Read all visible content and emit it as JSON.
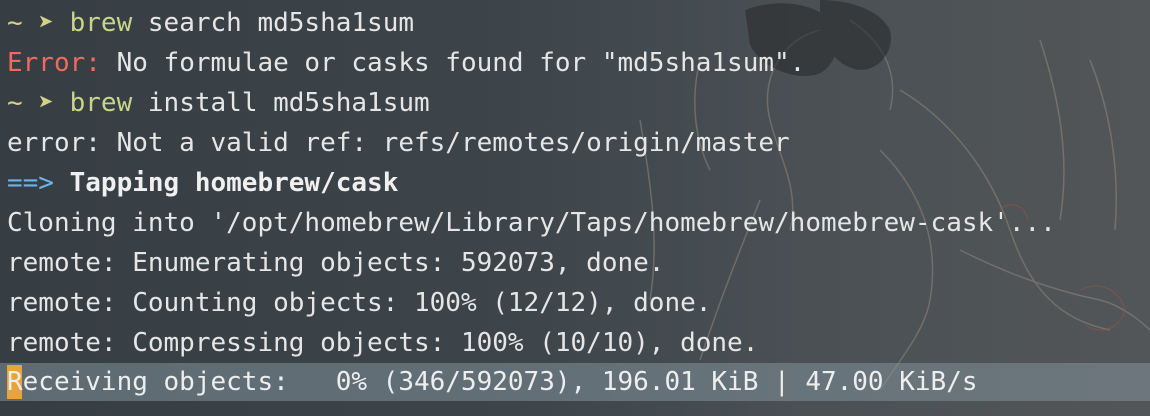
{
  "terminal": {
    "lines": [
      {
        "prompt": "~ ➤ ",
        "command": "brew",
        "args": " search md5sha1sum"
      },
      {
        "error_label": "Error:",
        "text": " No formulae or casks found for \"md5sha1sum\"."
      },
      {
        "prompt": "~ ➤ ",
        "command": "brew",
        "args": " install md5sha1sum"
      },
      {
        "text": "error: Not a valid ref: refs/remotes/origin/master"
      },
      {
        "arrow": "==>",
        "bold_text": " Tapping homebrew/cask"
      },
      {
        "text": "Cloning into '/opt/homebrew/Library/Taps/homebrew/homebrew-cask'..."
      },
      {
        "text": "remote: Enumerating objects: 592073, done."
      },
      {
        "text": "remote: Counting objects: 100% (12/12), done."
      },
      {
        "text": "remote: Compressing objects: 100% (10/10), done."
      }
    ],
    "status_line": "Receiving objects:   0% (346/592073), 196.01 KiB | 47.00 KiB/s"
  },
  "colors": {
    "background": "#3a4147",
    "prompt": "#d8cf8a",
    "command": "#c8d48a",
    "error": "#ef6a5f",
    "arrow": "#6cb4e8",
    "cursor": "#e8a33a"
  }
}
